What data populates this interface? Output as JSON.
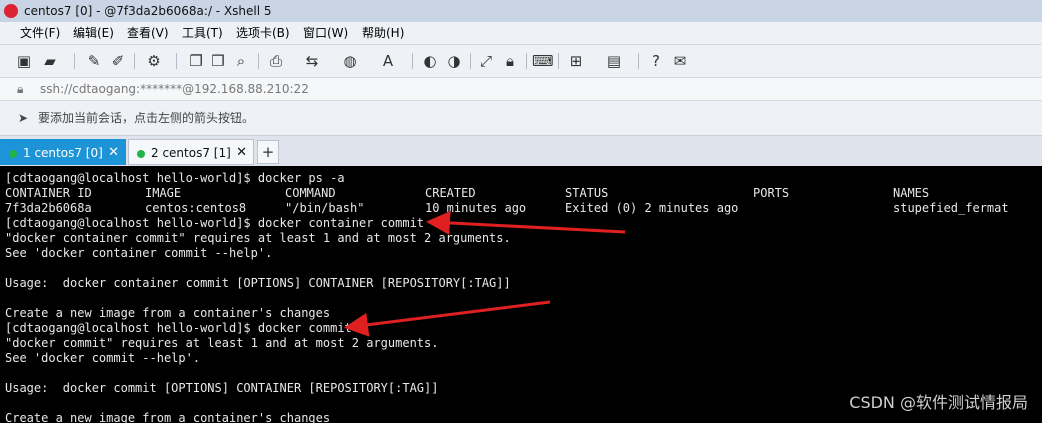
{
  "window": {
    "title": "centos7 [0] - @7f3da2b6068a:/ - Xshell 5"
  },
  "menu": [
    "文件(F)",
    "编辑(E)",
    "查看(V)",
    "工具(T)",
    "选项卡(B)",
    "窗口(W)",
    "帮助(H)"
  ],
  "address": {
    "value": "ssh://cdtaogang:*******@192.168.88.210:22"
  },
  "hint": {
    "text": "要添加当前会话，点击左侧的箭头按钮。"
  },
  "tabs": [
    {
      "label": "1 centos7 [0]",
      "active": true
    },
    {
      "label": "2 centos7 [1]",
      "active": false
    }
  ],
  "terminal": {
    "line1": "[cdtaogang@localhost hello-world]$ docker ps -a",
    "ps_headers": [
      "CONTAINER ID",
      "IMAGE",
      "COMMAND",
      "CREATED",
      "STATUS",
      "PORTS",
      "NAMES"
    ],
    "ps_row": [
      "7f3da2b6068a",
      "centos:centos8",
      "\"/bin/bash\"",
      "10 minutes ago",
      "Exited (0) 2 minutes ago",
      "",
      "stupefied_fermat"
    ],
    "line4": "[cdtaogang@localhost hello-world]$ docker container commit",
    "line5": "\"docker container commit\" requires at least 1 and at most 2 arguments.",
    "line6": "See 'docker container commit --help'.",
    "line8": "Usage:  docker container commit [OPTIONS] CONTAINER [REPOSITORY[:TAG]]",
    "line10": "Create a new image from a container's changes",
    "line11": "[cdtaogang@localhost hello-world]$ docker commit",
    "line12": "\"docker commit\" requires at least 1 and at most 2 arguments.",
    "line13": "See 'docker commit --help'.",
    "line15": "Usage:  docker commit [OPTIONS] CONTAINER [REPOSITORY[:TAG]]",
    "line17": "Create a new image from a container's changes"
  },
  "watermark": "CSDN @软件测试情报局",
  "colors": {
    "accent_tab": "#1e94d8",
    "annotation_arrow": "#e02020",
    "terminal_bg": "#000000"
  }
}
